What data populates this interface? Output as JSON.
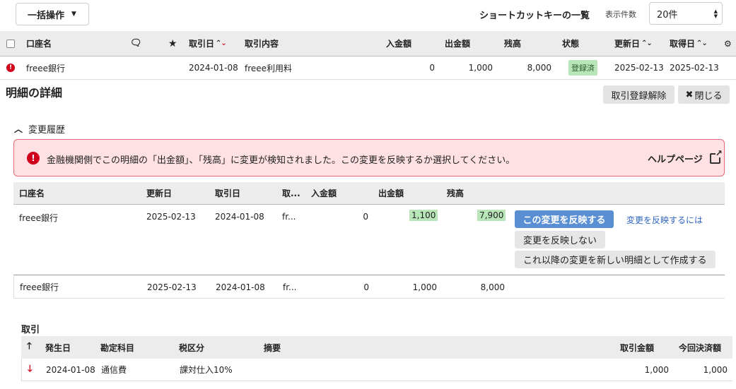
{
  "toolbar": {
    "bulk_label": "一括操作",
    "shortcut_label": "ショートカットキーの一覧",
    "perpage_label": "表示件数",
    "perpage_value": "20件"
  },
  "main_table": {
    "headers": {
      "account": "口座名",
      "date": "取引日",
      "description": "取引内容",
      "deposit": "入金額",
      "withdrawal": "出金額",
      "balance": "残高",
      "status": "状態",
      "updated": "更新日",
      "acquired": "取得日"
    },
    "row": {
      "account": "freee銀行",
      "date": "2024-01-08",
      "description": "freee利用料",
      "deposit": "0",
      "withdrawal": "1,000",
      "balance": "8,000",
      "status": "登録済",
      "updated": "2025-02-13",
      "acquired": "2025-02-13"
    }
  },
  "detail": {
    "title": "明細の詳細",
    "unregister_label": "取引登録解除",
    "close_label": "閉じる"
  },
  "history": {
    "toggle_label": "変更履歴",
    "alert_message": "金融機関側でこの明細の「出金額」、「残高」に変更が検知されました。この変更を反映するか選択してください。",
    "help_label": "ヘルプページ",
    "headers": {
      "account": "口座名",
      "updated": "更新日",
      "date": "取引日",
      "desc": "取...",
      "deposit": "入金額",
      "withdrawal": "出金額",
      "balance": "残高"
    },
    "rows": [
      {
        "account": "freee銀行",
        "updated": "2025-02-13",
        "date": "2024-01-08",
        "desc": "fr...",
        "deposit": "0",
        "withdrawal": "1,100",
        "balance": "7,900"
      },
      {
        "account": "freee銀行",
        "updated": "2025-02-13",
        "date": "2024-01-08",
        "desc": "fr...",
        "deposit": "0",
        "withdrawal": "1,000",
        "balance": "8,000"
      }
    ],
    "apply_label": "この変更を反映する",
    "howto_label": "変更を反映するには",
    "reject_label": "変更を反映しない",
    "create_new_label": "これ以降の変更を新しい明細として作成する"
  },
  "transactions": {
    "title": "取引",
    "headers": {
      "date": "発生日",
      "account_item": "勘定科目",
      "tax": "税区分",
      "memo": "摘要",
      "amount": "取引金額",
      "settled": "今回決済額"
    },
    "row": {
      "date": "2024-01-08",
      "account_item": "通信費",
      "tax": "課対仕入10%",
      "memo": "",
      "amount": "1,000",
      "settled": "1,000"
    }
  },
  "colors": {
    "accent_blue": "#5a8fd4",
    "alert_red": "#d0021b",
    "alert_bg": "#ffe0e3",
    "highlight_green": "#b9e6b9"
  }
}
